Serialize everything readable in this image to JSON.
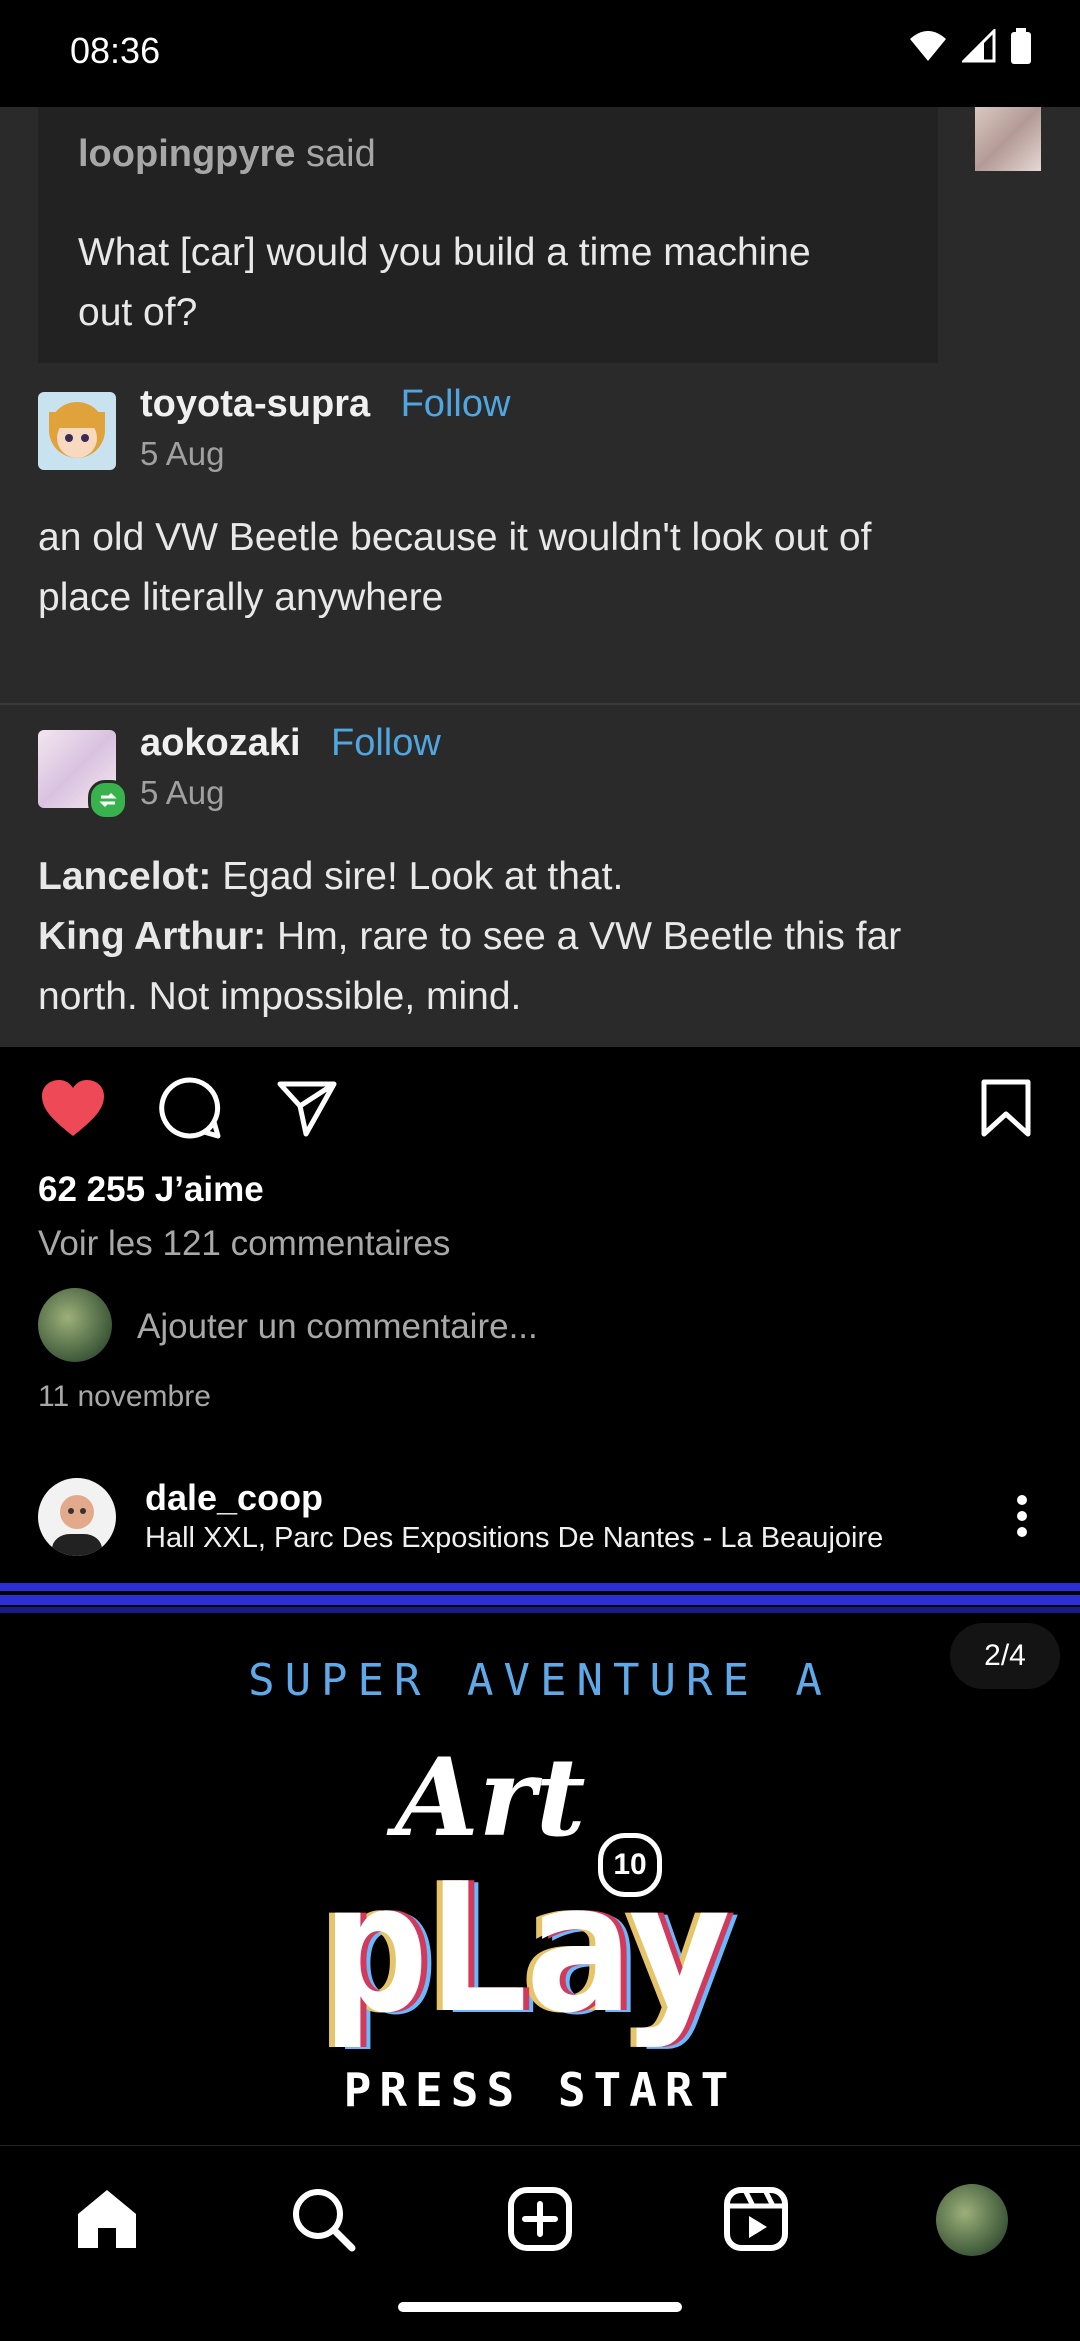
{
  "status_bar": {
    "time": "08:36"
  },
  "tumblr": {
    "quote": {
      "author": "loopingpyre",
      "said": "said",
      "question_line1": "What [car] would you build a time machine",
      "question_line2": "out of?"
    },
    "post1": {
      "username": "toyota-supra",
      "follow": "Follow",
      "date": "5 Aug",
      "text_line1": "an old VW Beetle because it wouldn't look out of",
      "text_line2": "place literally anywhere"
    },
    "post2": {
      "username": "aokozaki",
      "follow": "Follow",
      "date": "5 Aug",
      "line1_speaker": "Lancelot:",
      "line1_text": " Egad sire! Look at that.",
      "line2_speaker": "King Arthur:",
      "line2_text": " Hm, rare to see a VW Beetle this far",
      "line3_text": "north. Not impossible, mind."
    }
  },
  "instagram": {
    "likes": "62 255 J’aime",
    "view_comments": "Voir les 121 commentaires",
    "add_comment_placeholder": "Ajouter un commentaire...",
    "post_date": "11 novembre",
    "next_post": {
      "username": "dale_coop",
      "location": "Hall XXL, Parc Des Expositions De Nantes - La Beaujoire",
      "carousel_indicator": "2/4",
      "game_title_top": "SUPER AVENTURE A",
      "game_logo_word1": "Art",
      "game_logo_badge": "10",
      "game_logo_word2": "pLay",
      "press_start": "PRESS START"
    }
  },
  "colors": {
    "like_red": "#ed4956",
    "follow_blue": "#4fa6e0",
    "game_blue": "#2d2fd6"
  }
}
